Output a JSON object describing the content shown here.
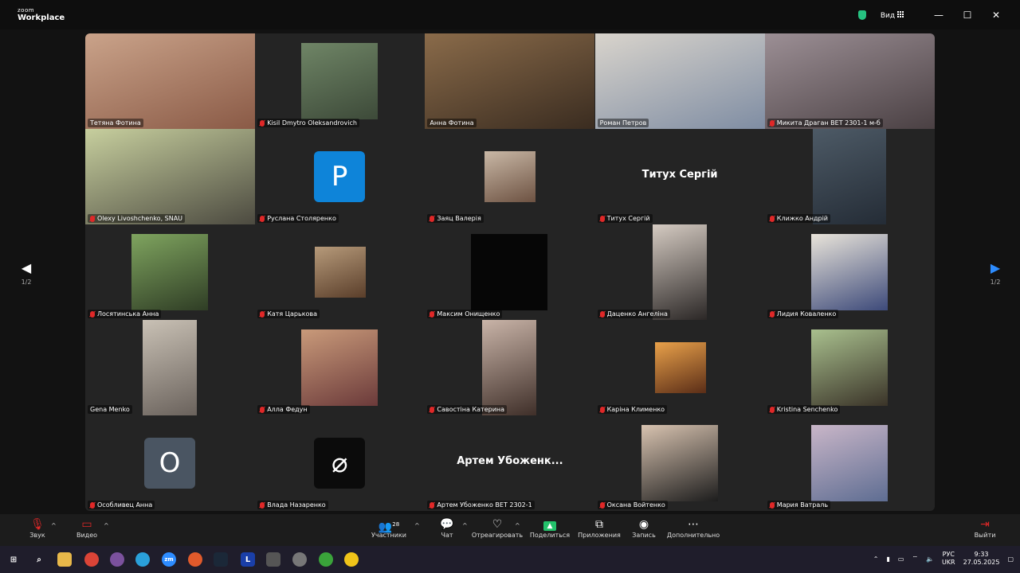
{
  "app": {
    "logo_top": "zoom",
    "logo_bottom": "Workplace",
    "view_label": "Вид"
  },
  "nav": {
    "page": "1/2"
  },
  "tiles": [
    {
      "name": "Тетяна Фотина",
      "muted": false,
      "kind": "video",
      "colors": [
        "#caa38a",
        "#8a5a46"
      ]
    },
    {
      "name": "Kisil Dmytro Oleksandrovich",
      "muted": true,
      "kind": "video",
      "colors": [
        "#6f8566",
        "#3d4a39"
      ]
    },
    {
      "name": "Анна Фотина",
      "muted": false,
      "kind": "video",
      "colors": [
        "#8a6b4a",
        "#3a2c20"
      ]
    },
    {
      "name": "Роман Петров",
      "muted": false,
      "kind": "video",
      "colors": [
        "#d9d4cc",
        "#7f8da3"
      ]
    },
    {
      "name": "Микита Драган ВЕТ 2301-1 м-б",
      "muted": true,
      "kind": "video",
      "colors": [
        "#9c8f95",
        "#4a4043"
      ]
    },
    {
      "name": "Olexy Livoshchenko, SNAU",
      "muted": true,
      "kind": "video",
      "colors": [
        "#c7cf9e",
        "#4c4a40"
      ]
    },
    {
      "name": "Руслана Столяренко",
      "muted": true,
      "kind": "avatar",
      "letter": "P",
      "color": "#0e84d9"
    },
    {
      "name": "Заяц Валерія",
      "muted": true,
      "kind": "video",
      "colors": [
        "#c9b8a6",
        "#6d5242"
      ]
    },
    {
      "name": "Титух Сергій",
      "muted": true,
      "kind": "text",
      "bigname": "Титух Сергій"
    },
    {
      "name": "Клижко Андрій",
      "muted": true,
      "kind": "video",
      "colors": [
        "#4d5a66",
        "#242c36"
      ]
    },
    {
      "name": "Лосятинська Анна",
      "muted": true,
      "kind": "video",
      "colors": [
        "#7fa45f",
        "#2f3d25"
      ]
    },
    {
      "name": "Катя Царькова",
      "muted": true,
      "kind": "video",
      "colors": [
        "#b69a7a",
        "#5a3e2a"
      ]
    },
    {
      "name": "Максим Онищенко",
      "muted": true,
      "kind": "video",
      "colors": [
        "#060606",
        "#060606"
      ]
    },
    {
      "name": "Даценко Ангеліна",
      "muted": true,
      "kind": "video",
      "colors": [
        "#d5cbc2",
        "#2b2726"
      ]
    },
    {
      "name": "Лидия Коваленко",
      "muted": true,
      "kind": "video",
      "colors": [
        "#e9e4da",
        "#3d4a7a"
      ]
    },
    {
      "name": "Gena Menko",
      "muted": false,
      "kind": "video",
      "colors": [
        "#c9c1b5",
        "#6a625c"
      ]
    },
    {
      "name": "Алла Федун",
      "muted": true,
      "kind": "video",
      "colors": [
        "#c99a7a",
        "#6b3a3a"
      ]
    },
    {
      "name": "Савостіна Катерина",
      "muted": true,
      "kind": "video",
      "colors": [
        "#c9b4a8",
        "#3f2f29"
      ]
    },
    {
      "name": "Каріна Клименко",
      "muted": true,
      "kind": "video",
      "colors": [
        "#e9a14a",
        "#5a2d17"
      ]
    },
    {
      "name": "Kristina Senchenko",
      "muted": true,
      "kind": "video",
      "colors": [
        "#a9c08e",
        "#3a3328"
      ]
    },
    {
      "name": "Особливец Анна",
      "muted": true,
      "kind": "avatar",
      "letter": "O",
      "color": "#4a5562"
    },
    {
      "name": "Влада Назаренко",
      "muted": true,
      "kind": "avatar",
      "letter": "⌀",
      "color": "#0b0b0b"
    },
    {
      "name": "Артем Убоженко ВЕТ 2302-1",
      "muted": true,
      "kind": "text",
      "bigname": "Артем Убоженк..."
    },
    {
      "name": "Оксана Войтенко",
      "muted": true,
      "kind": "video",
      "colors": [
        "#d8c3b0",
        "#1d1d1d"
      ]
    },
    {
      "name": "Мария Ватраль",
      "muted": true,
      "kind": "video",
      "colors": [
        "#c9b6c8",
        "#5e6d92"
      ]
    }
  ],
  "toolbar": {
    "audio": "Звук",
    "video": "Видео",
    "participants": "Участники",
    "participants_count": "28",
    "chat": "Чат",
    "react": "Отреагировать",
    "share": "Поделиться",
    "apps": "Приложения",
    "record": "Запись",
    "more": "Дополнительно",
    "leave": "Выйти"
  },
  "taskbar": {
    "lang_top": "РУС",
    "lang_bottom": "UKR",
    "time": "9:33",
    "date": "27.05.2025"
  }
}
